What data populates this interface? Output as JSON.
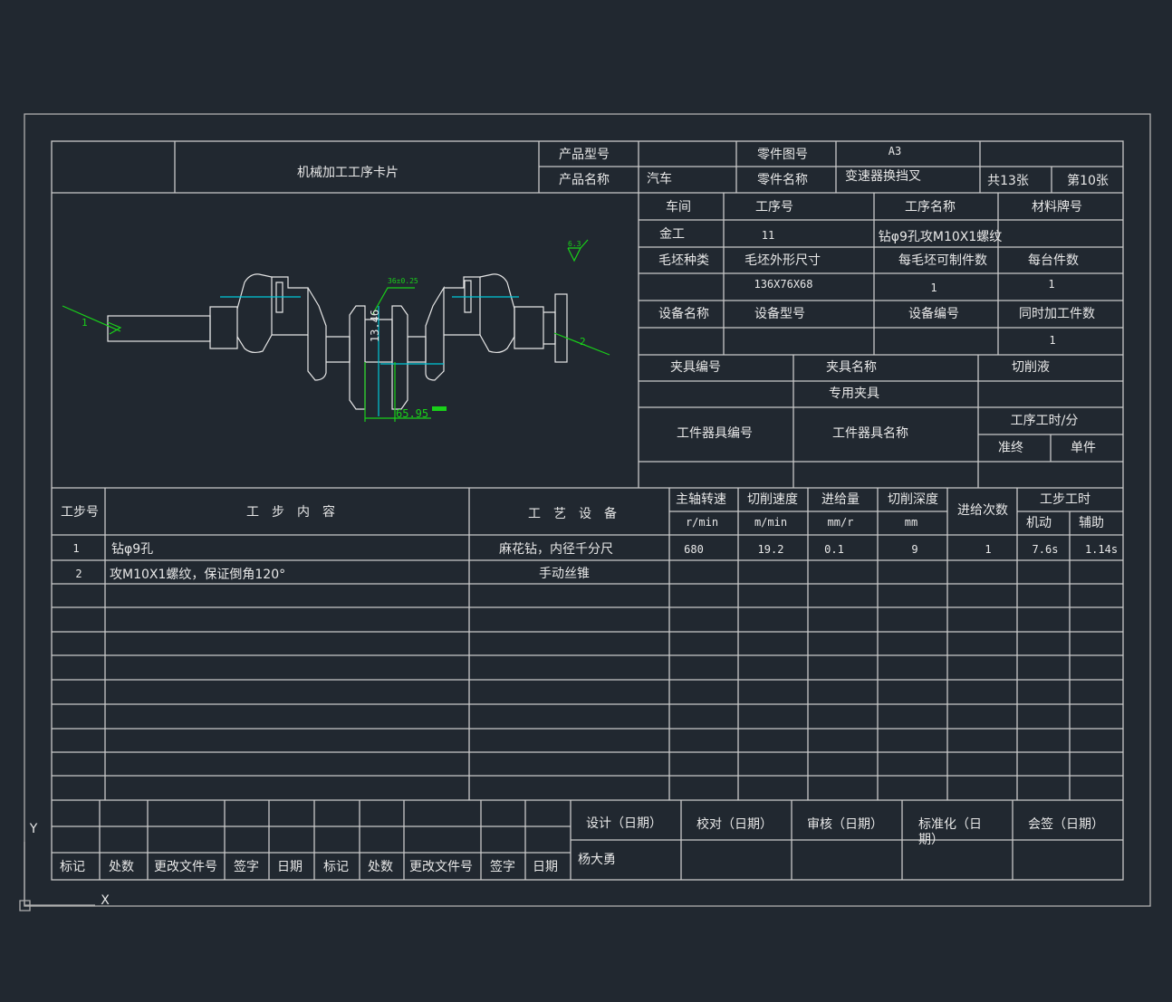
{
  "colors": {
    "background": "#212830",
    "lines": "#c9c9c9",
    "dimension": "#19d019",
    "centerline": "#00c8d8"
  },
  "header": {
    "title": "机械加工工序卡片",
    "product_model_label": "产品型号",
    "product_name_label": "产品名称",
    "product_name": "汽车",
    "part_drawing_label": "零件图号",
    "part_drawing_no": "A3",
    "part_name_label": "零件名称",
    "part_name": "变速器换挡叉",
    "total_sheets": "共13张",
    "sheet_no": "第10张"
  },
  "info": {
    "workshop_label": "车间",
    "op_no_label": "工序号",
    "op_name_label": "工序名称",
    "material_label": "材料牌号",
    "workshop": "金工",
    "op_no": "11",
    "op_name": "钻φ9孔攻M10X1螺纹",
    "blank_type_label": "毛坯种类",
    "blank_size_label": "毛坯外形尺寸",
    "parts_per_blank_label": "每毛坯可制件数",
    "parts_per_unit_label": "每台件数",
    "blank_size": "136X76X68",
    "parts_per_blank": "1",
    "parts_per_unit": "1",
    "equip_name_label": "设备名称",
    "equip_model_label": "设备型号",
    "equip_no_label": "设备编号",
    "simul_parts_label": "同时加工件数",
    "simul_parts": "1",
    "fixture_no_label": "夹具编号",
    "fixture_name_label": "夹具名称",
    "coolant_label": "切削液",
    "fixture_name": "专用夹具",
    "tool_no_label": "工件器具编号",
    "tool_name_label": "工件器具名称",
    "op_time_label": "工序工时/分",
    "prep_label": "准终",
    "unit_label": "单件"
  },
  "drawing": {
    "dim_vertical": "13.46",
    "dim_horizontal": "65.95",
    "tolerance": "36±0.25",
    "roughness": "6.3",
    "datum_left": "1",
    "datum_right": "2",
    "axis_x": "X",
    "axis_y": "Y"
  },
  "steps": {
    "headers": {
      "no": "工步号",
      "content": "工　步　内　容",
      "equipment": "工　艺　设　备",
      "spindle": "主轴转速",
      "speed": "切削速度",
      "feed": "进给量",
      "depth": "切削深度",
      "passes": "进给次数",
      "time": "工步工时",
      "spindle_unit": "r/min",
      "speed_unit": "m/min",
      "feed_unit": "mm/r",
      "depth_unit": "mm",
      "machine": "机动",
      "aux": "辅助"
    },
    "rows": [
      {
        "no": "1",
        "content": "钻φ9孔",
        "equipment": "麻花钻，内径千分尺",
        "spindle": "680",
        "speed": "19.2",
        "feed": "0.1",
        "depth": "9",
        "passes": "1",
        "machine": "7.6s",
        "aux": "1.14s"
      },
      {
        "no": "2",
        "content": "攻M10X1螺纹，保证倒角120°",
        "equipment": "手动丝锥"
      }
    ]
  },
  "signoff": {
    "design": "设计（日期）",
    "check": "校对（日期）",
    "review": "审核（日期）",
    "standard_1": "标准化（日",
    "standard_2": "期）",
    "countersign": "会签（日期）",
    "designer": "杨大勇",
    "rev": [
      "标记",
      "处数",
      "更改文件号",
      "签字",
      "日期",
      "标记",
      "处数",
      "更改文件号",
      "签字",
      "日期"
    ]
  }
}
